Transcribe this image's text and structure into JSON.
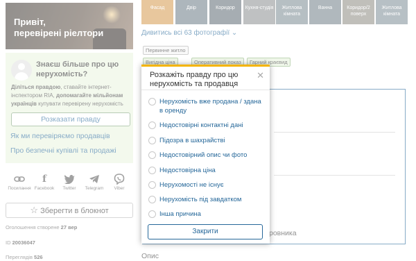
{
  "promo": {
    "title": "Привіт,\nперевірені ріелтори"
  },
  "info": {
    "question": "Знаєш більше про цю нерухомість?",
    "desc_part1": "Діліться правдою",
    "desc_part2": ", ставайте інтернет-інспектором RIA, ",
    "desc_part3": "допомагайте мільйонам українців",
    "desc_part4": " купувати перевірену нерухомість",
    "tell_button": "Розказати правду"
  },
  "links": {
    "check_sellers": "Як ми перевіряємо продавців",
    "safe_deal": "Про безпечні купівлі та продажі"
  },
  "share": [
    {
      "label": "Посилання",
      "icon": "link-icon"
    },
    {
      "label": "Facebook",
      "icon": "facebook-icon"
    },
    {
      "label": "Twitter",
      "icon": "twitter-icon"
    },
    {
      "label": "Telegram",
      "icon": "telegram-icon"
    },
    {
      "label": "Viber",
      "icon": "viber-icon"
    }
  ],
  "save_button": "Зберегти в блокнот",
  "meta": {
    "created_label": "Оголошення створене",
    "created_value": "27 вер",
    "id_label": "ID",
    "id_value": "20036047",
    "views_label": "Переглядів",
    "views_value": "526"
  },
  "gallery": {
    "thumbs": [
      "Фасад",
      "Двір",
      "Коридор",
      "Кухня-студія",
      "Житлова кімната",
      "Ванна",
      "Коридор/2 поверх",
      "Житлова кімната"
    ],
    "all_photos_link": "Дивитись всі 63 фотографії"
  },
  "tags": {
    "primary": "Первинне житло",
    "green": [
      "Вигідна ціна",
      "Оперативний показ",
      "Гарний краєвид"
    ]
  },
  "background": {
    "agent_partial": "ровника",
    "description_heading": "Опис"
  },
  "modal": {
    "title": "Розкажіть правду про цю нерухомість та продавця",
    "options": [
      "Нерухомість вже продана / здана в оренду",
      "Недостовірні контактні дані",
      "Підозра в шахрайстві",
      "Недостовірний опис чи фото",
      "Недостовірна ціна",
      "Нерухомості не існує",
      "Нерухомість під завдатком",
      "Інша причина"
    ],
    "close_button": "Закрити"
  },
  "colors": {
    "accent": "#256799",
    "modal_top": "#f4b400",
    "info_bg": "#e9f4df"
  }
}
